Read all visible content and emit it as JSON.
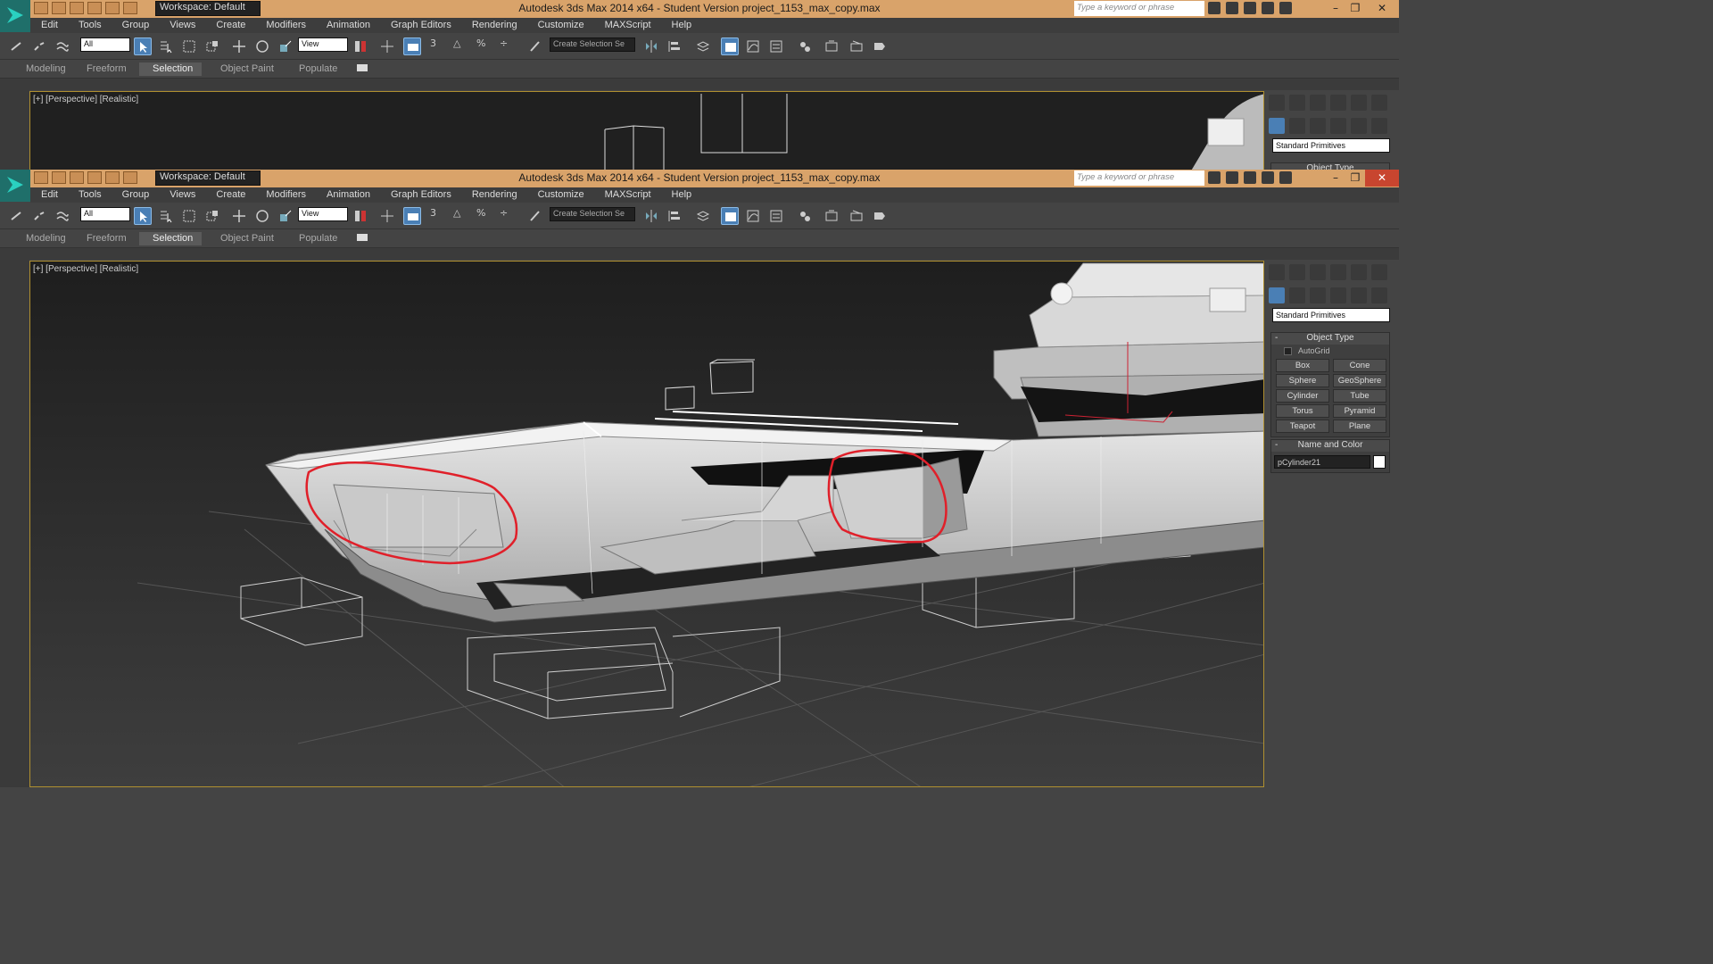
{
  "window": {
    "title": "Autodesk 3ds Max  2014 x64  - Student Version    project_1153_max_copy.max",
    "workspace": "Workspace: Default",
    "search_placeholder": "Type a keyword or phrase",
    "minimize": "–",
    "restore": "❐",
    "close": "✕"
  },
  "menu": [
    "Edit",
    "Tools",
    "Group",
    "Views",
    "Create",
    "Modifiers",
    "Animation",
    "Graph Editors",
    "Rendering",
    "Customize",
    "MAXScript",
    "Help"
  ],
  "toolbar": {
    "selection_filter": "All",
    "ref_coord": "View",
    "named_selection_placeholder": "Create Selection Se",
    "snap_label": "3",
    "angle_snap_label": "△",
    "percent_snap_label": "%",
    "spinner_snap_label": "÷"
  },
  "ribbon": {
    "tabs": [
      "Modeling",
      "Freeform",
      "Selection",
      "Object Paint",
      "Populate"
    ],
    "selected": "Selection"
  },
  "viewport": {
    "label": "[+] [Perspective] [Realistic]"
  },
  "command_panel": {
    "dropdown": "Standard Primitives",
    "object_type": {
      "title": "Object Type",
      "collapse": "-",
      "autogrid": "AutoGrid",
      "buttons": [
        "Box",
        "Cone",
        "Sphere",
        "GeoSphere",
        "Cylinder",
        "Tube",
        "Torus",
        "Pyramid",
        "Teapot",
        "Plane"
      ]
    },
    "name_and_color": {
      "title": "Name and Color",
      "collapse": "-",
      "name": "pCylinder21",
      "color": "#ffffff"
    }
  },
  "colors": {
    "titlebar": "#d9a36a",
    "viewport_border": "#b09030",
    "annotation": "#e0202a",
    "active_button": "#4a7fb5"
  }
}
